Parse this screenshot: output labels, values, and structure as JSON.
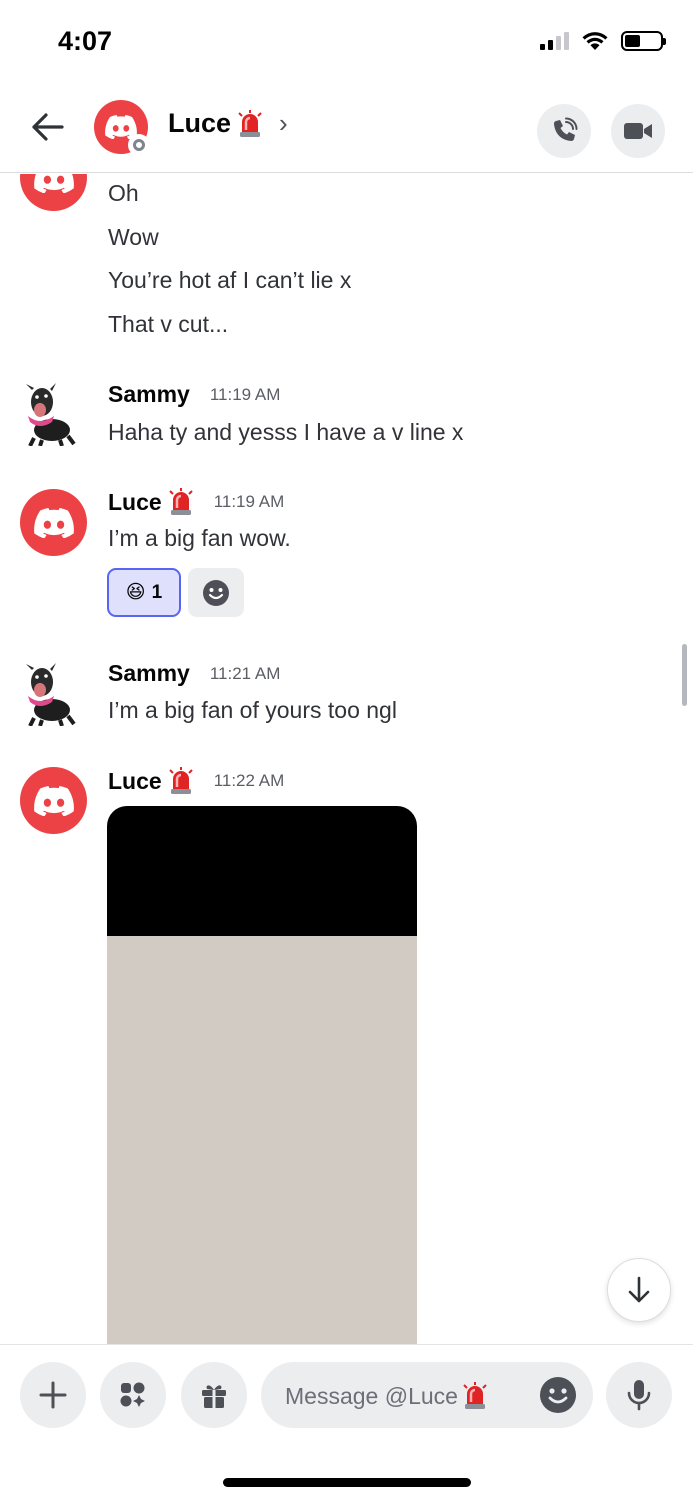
{
  "status_bar": {
    "time": "4:07"
  },
  "header": {
    "name": "Luce",
    "chevron": "›"
  },
  "messages": {
    "cont": [
      "Oh",
      "Wow",
      "You’re hot af I can’t lie x",
      "That v cut..."
    ],
    "m1": {
      "author": "Sammy",
      "time": "11:19 AM",
      "text": "Haha ty and yesss I have a v line x"
    },
    "m2": {
      "author": "Luce",
      "time": "11:19 AM",
      "text": "I’m a big fan wow.",
      "reaction": {
        "emoji": "😆",
        "count": "1"
      }
    },
    "m3": {
      "author": "Sammy",
      "time": "11:21 AM",
      "text": "I’m a big fan of yours too ngl"
    },
    "m4": {
      "author": "Luce",
      "time": "11:22 AM",
      "image": {
        "alt": ""
      }
    }
  },
  "composer": {
    "placeholder": "Message @Luce"
  },
  "icons": {
    "back": "arrow-left-icon",
    "call": "phone-icon",
    "video": "video-camera-icon",
    "plus": "plus-icon",
    "apps": "apps-icon",
    "gift": "gift-icon",
    "emoji": "emoji-face-icon",
    "mic": "microphone-icon",
    "jump": "arrow-down-icon"
  },
  "colors": {
    "brand_red": "#ed4245",
    "blurple": "#5865f2",
    "reaction_bg": "#dee0fc"
  }
}
